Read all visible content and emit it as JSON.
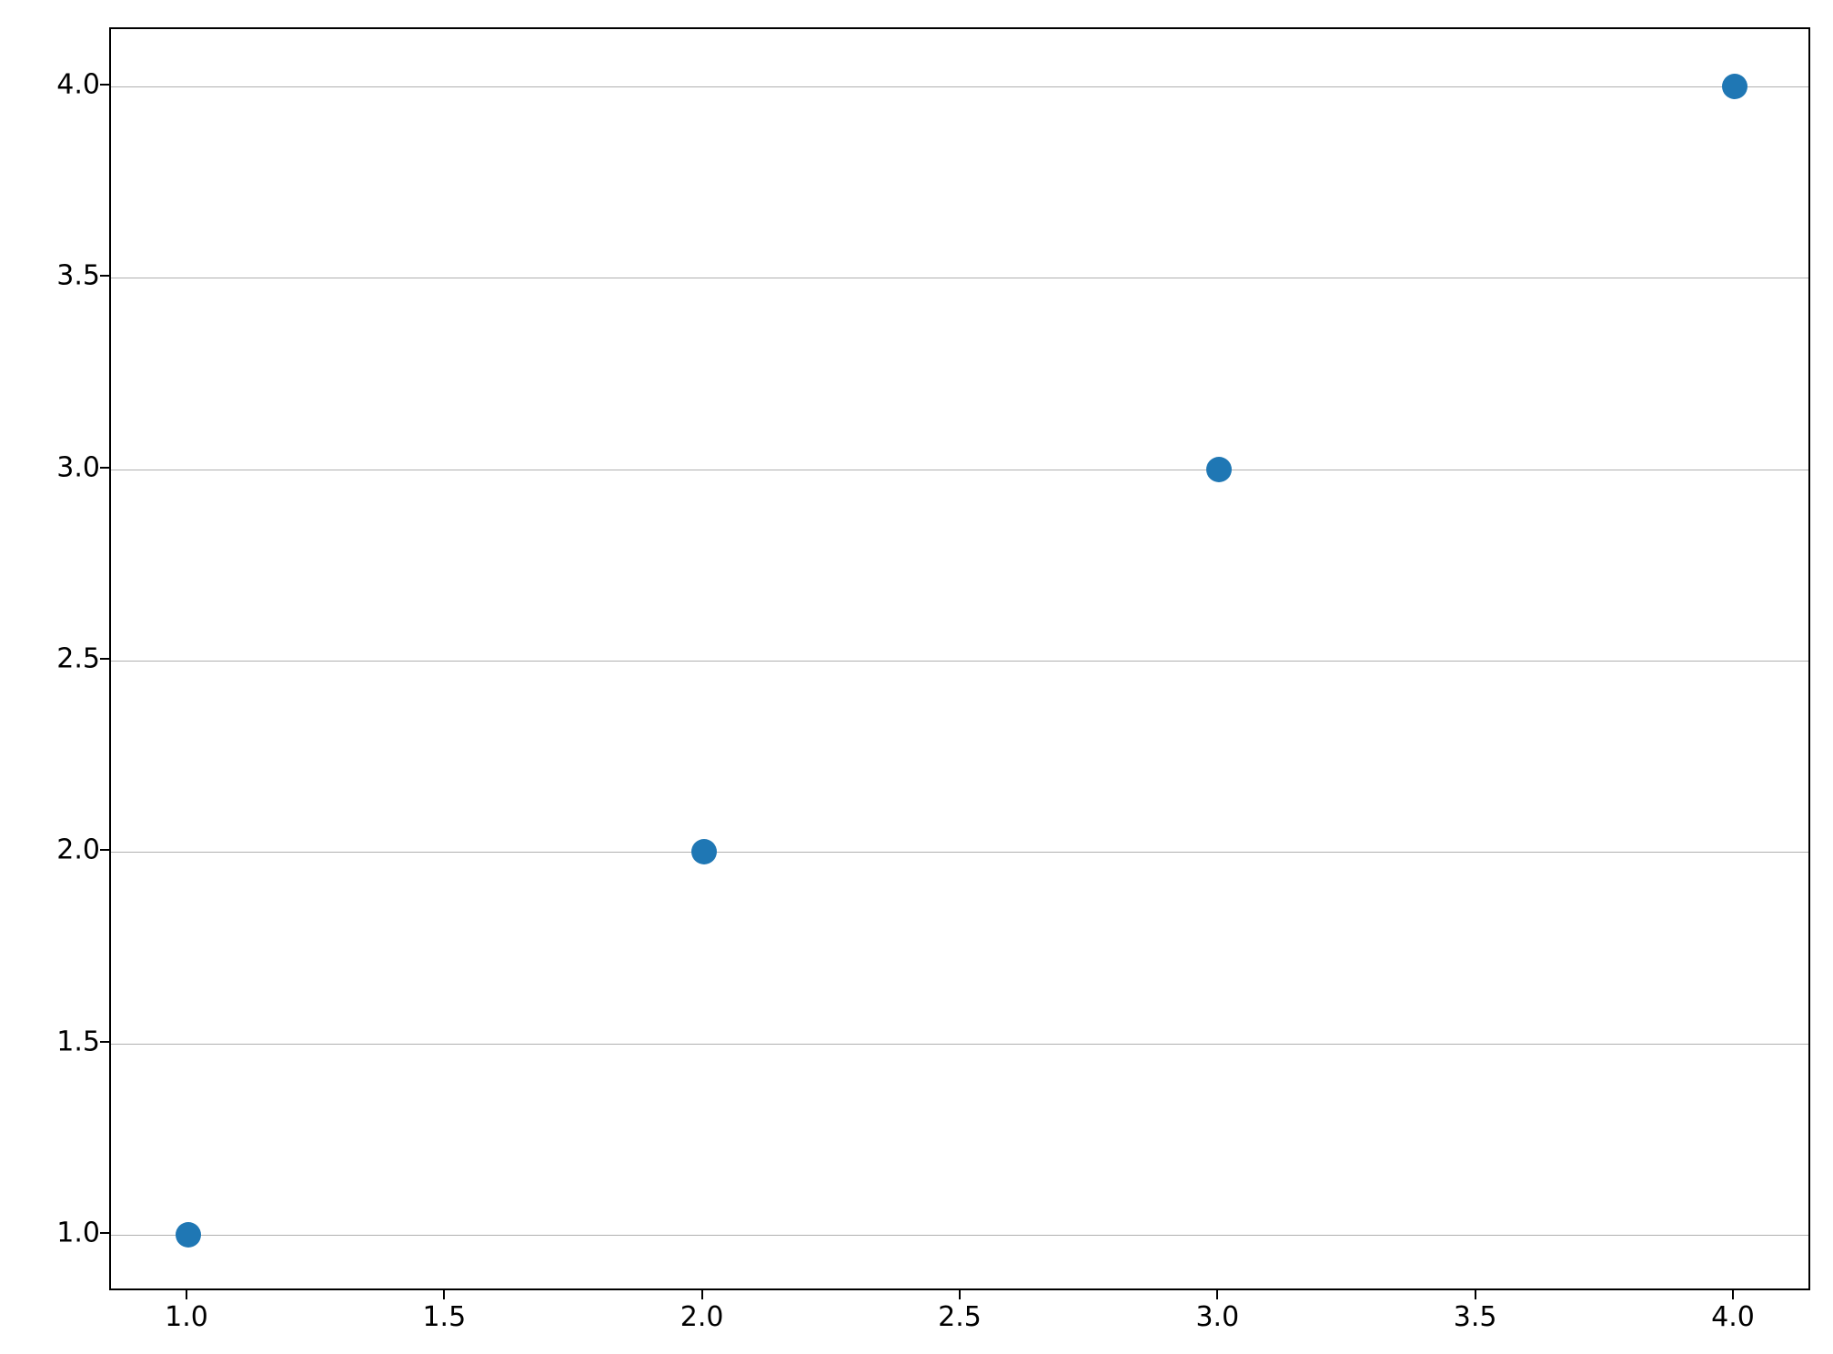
{
  "chart_data": {
    "type": "scatter",
    "x": [
      1,
      2,
      3,
      4
    ],
    "y": [
      1,
      2,
      3,
      4
    ],
    "title": "",
    "xlabel": "",
    "ylabel": "",
    "xlim": [
      0.85,
      4.15
    ],
    "ylim": [
      0.85,
      4.15
    ],
    "xticks": [
      1.0,
      1.5,
      2.0,
      2.5,
      3.0,
      3.5,
      4.0
    ],
    "yticks": [
      1.0,
      1.5,
      2.0,
      2.5,
      3.0,
      3.5,
      4.0
    ],
    "xtick_labels": [
      "1.0",
      "1.5",
      "2.0",
      "2.5",
      "3.0",
      "3.5",
      "4.0"
    ],
    "ytick_labels": [
      "1.0",
      "1.5",
      "2.0",
      "2.5",
      "3.0",
      "3.5",
      "4.0"
    ],
    "grid": "y",
    "marker_color": "#1f77b4",
    "marker_size": 28
  }
}
